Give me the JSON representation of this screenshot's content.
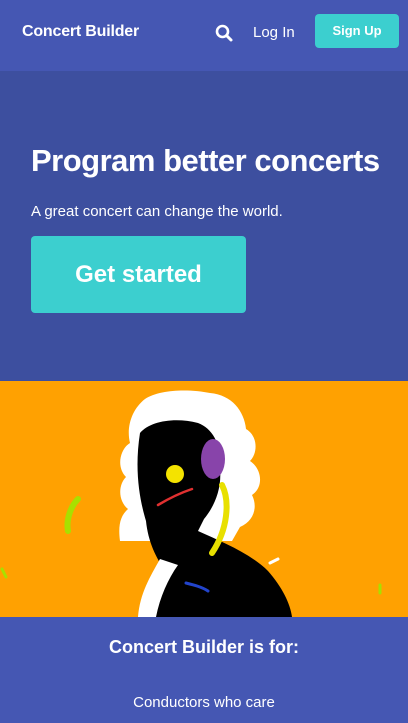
{
  "nav": {
    "brand": "Concert Builder",
    "login_label": "Log In",
    "signup_label": "Sign Up"
  },
  "hero": {
    "title": "Program better concerts",
    "subtitle": "A great concert can change the world.",
    "cta_label": "Get started"
  },
  "audience": {
    "title": "Concert Builder is for:",
    "items": [
      "Conductors who care"
    ]
  },
  "colors": {
    "nav_bg": "#4557b3",
    "hero_bg": "#3d4f9f",
    "accent": "#3ccfcf",
    "illustration_bg": "#ffa101"
  },
  "icons": {
    "search": "search-icon"
  }
}
